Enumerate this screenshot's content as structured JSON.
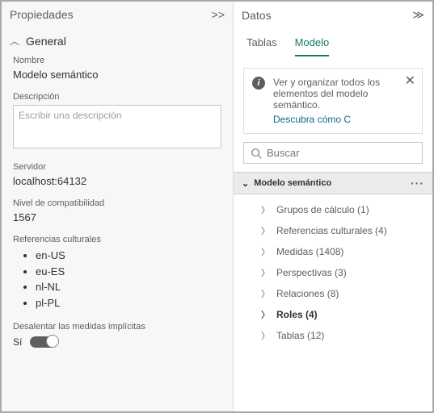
{
  "left": {
    "title": "Propiedades",
    "section": "General",
    "name_label": "Nombre",
    "name_value": "Modelo semántico",
    "desc_label": "Descripción",
    "desc_placeholder": "Escribir una descripción",
    "server_label": "Servidor",
    "server_value": "localhost:64132",
    "compat_label": "Nivel de compatibilidad",
    "compat_value": "1567",
    "cultures_label": "Referencias culturales",
    "cultures": [
      "en-US",
      "eu-ES",
      "nl-NL",
      "pl-PL"
    ],
    "toggle_label": "Desalentar las medidas implícitas",
    "toggle_value": "Sí"
  },
  "right": {
    "title": "Datos",
    "tabs": {
      "tablas": "Tablas",
      "modelo": "Modelo"
    },
    "banner": {
      "line1": "Ver y organizar todos los",
      "line2": "elementos del modelo semántico.",
      "link": "Descubra cómo C"
    },
    "search_placeholder": "Buscar",
    "root": "Modelo semántico",
    "items": [
      {
        "label": "Grupos de cálculo (1)",
        "strong": false
      },
      {
        "label": "Referencias culturales (4)",
        "strong": false
      },
      {
        "label": "Medidas (1408)",
        "strong": false
      },
      {
        "label": "Perspectivas (3)",
        "strong": false
      },
      {
        "label": "Relaciones (8)",
        "strong": false
      },
      {
        "label": "Roles (4)",
        "strong": true
      },
      {
        "label": "Tablas (12)",
        "strong": false
      }
    ]
  }
}
